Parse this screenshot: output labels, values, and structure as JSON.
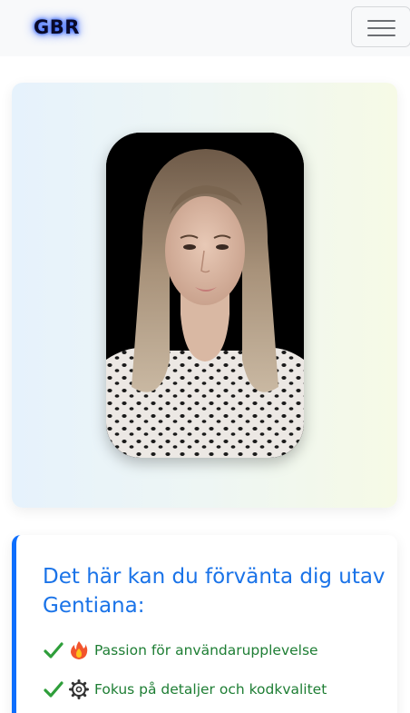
{
  "navbar": {
    "brand": "GBR",
    "menu_icon": "hamburger-menu-icon"
  },
  "hero": {
    "image": "portrait-photo"
  },
  "expectations": {
    "title": "Det här kan du förvänta dig utav Gentiana:",
    "items": [
      {
        "check_icon": "check-icon",
        "emoji_icon": "fire-icon",
        "label": "Passion för användarupplevelse"
      },
      {
        "check_icon": "check-icon",
        "emoji_icon": "gear-icon",
        "label": "Fokus på detaljer och kodkvalitet"
      }
    ]
  },
  "colors": {
    "accent": "#0d6efd",
    "title": "#1a73e8",
    "feature_text": "#1e7e34",
    "check": "#2e9e3a"
  }
}
